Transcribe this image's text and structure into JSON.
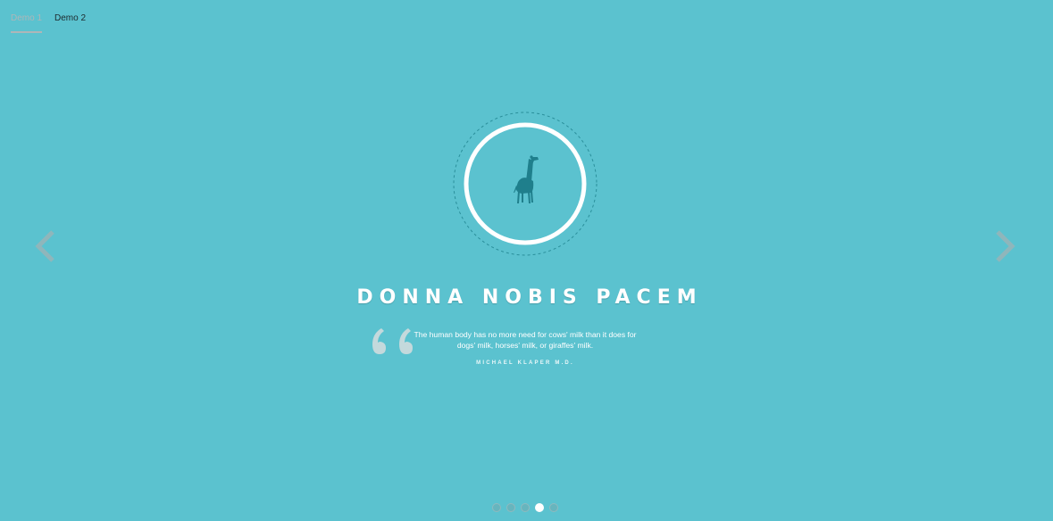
{
  "nav": {
    "items": [
      {
        "label": "Demo 1",
        "active": true
      },
      {
        "label": "Demo 2",
        "active": false
      }
    ]
  },
  "slide": {
    "icon": "giraffe-icon",
    "title": "DONNA NOBIS PACEM",
    "quote": "The human body has no more need for cows' milk than it does for dogs' milk, horses' milk, or giraffes' milk.",
    "author": "MICHAEL KLAPER M.D."
  },
  "pagination": {
    "count": 5,
    "active_index": 3
  },
  "colors": {
    "background": "#5bc2cf",
    "icon": "#1f7f8c",
    "ring": "#ffffff",
    "arrow": "#8fb6bb"
  }
}
